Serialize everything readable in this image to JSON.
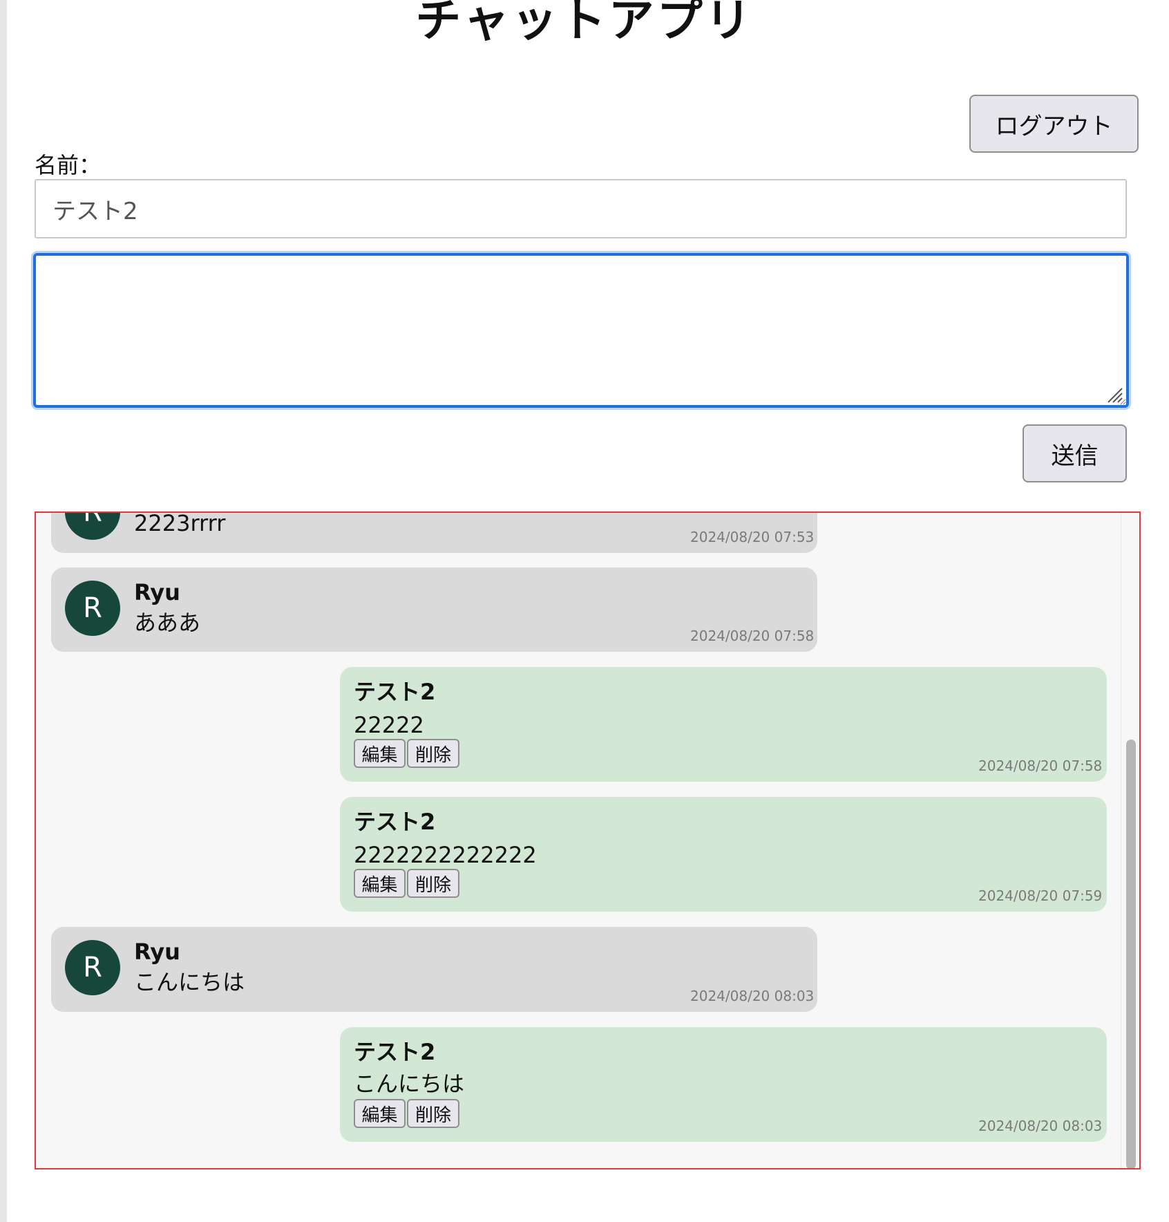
{
  "app": {
    "title": "チャットアプリ",
    "logout_label": "ログアウト"
  },
  "form": {
    "name_label": "名前：",
    "name_value": "テスト2",
    "message_value": "",
    "send_label": "送信"
  },
  "chat": {
    "edit_label": "編集",
    "delete_label": "削除",
    "messages": [
      {
        "side": "other",
        "avatar_initial": "R",
        "sender": "",
        "text": "2223rrrr",
        "time": "2024/08/20 07:53"
      },
      {
        "side": "other",
        "avatar_initial": "R",
        "sender": "Ryu",
        "text": "あああ",
        "time": "2024/08/20 07:58"
      },
      {
        "side": "self",
        "sender": "テスト2",
        "text": "22222",
        "time": "2024/08/20 07:58"
      },
      {
        "side": "self",
        "sender": "テスト2",
        "text": "2222222222222",
        "time": "2024/08/20 07:59"
      },
      {
        "side": "other",
        "avatar_initial": "R",
        "sender": "Ryu",
        "text": "こんにちは",
        "time": "2024/08/20 08:03"
      },
      {
        "side": "self",
        "sender": "テスト2",
        "text": "こんにちは",
        "time": "2024/08/20 08:03"
      }
    ]
  },
  "colors": {
    "other_bubble": "#dadada",
    "self_bubble": "#d2e8d4",
    "avatar_bg": "#17473b",
    "chat_border": "#e23a3a",
    "focus_border": "#1f6fde"
  }
}
